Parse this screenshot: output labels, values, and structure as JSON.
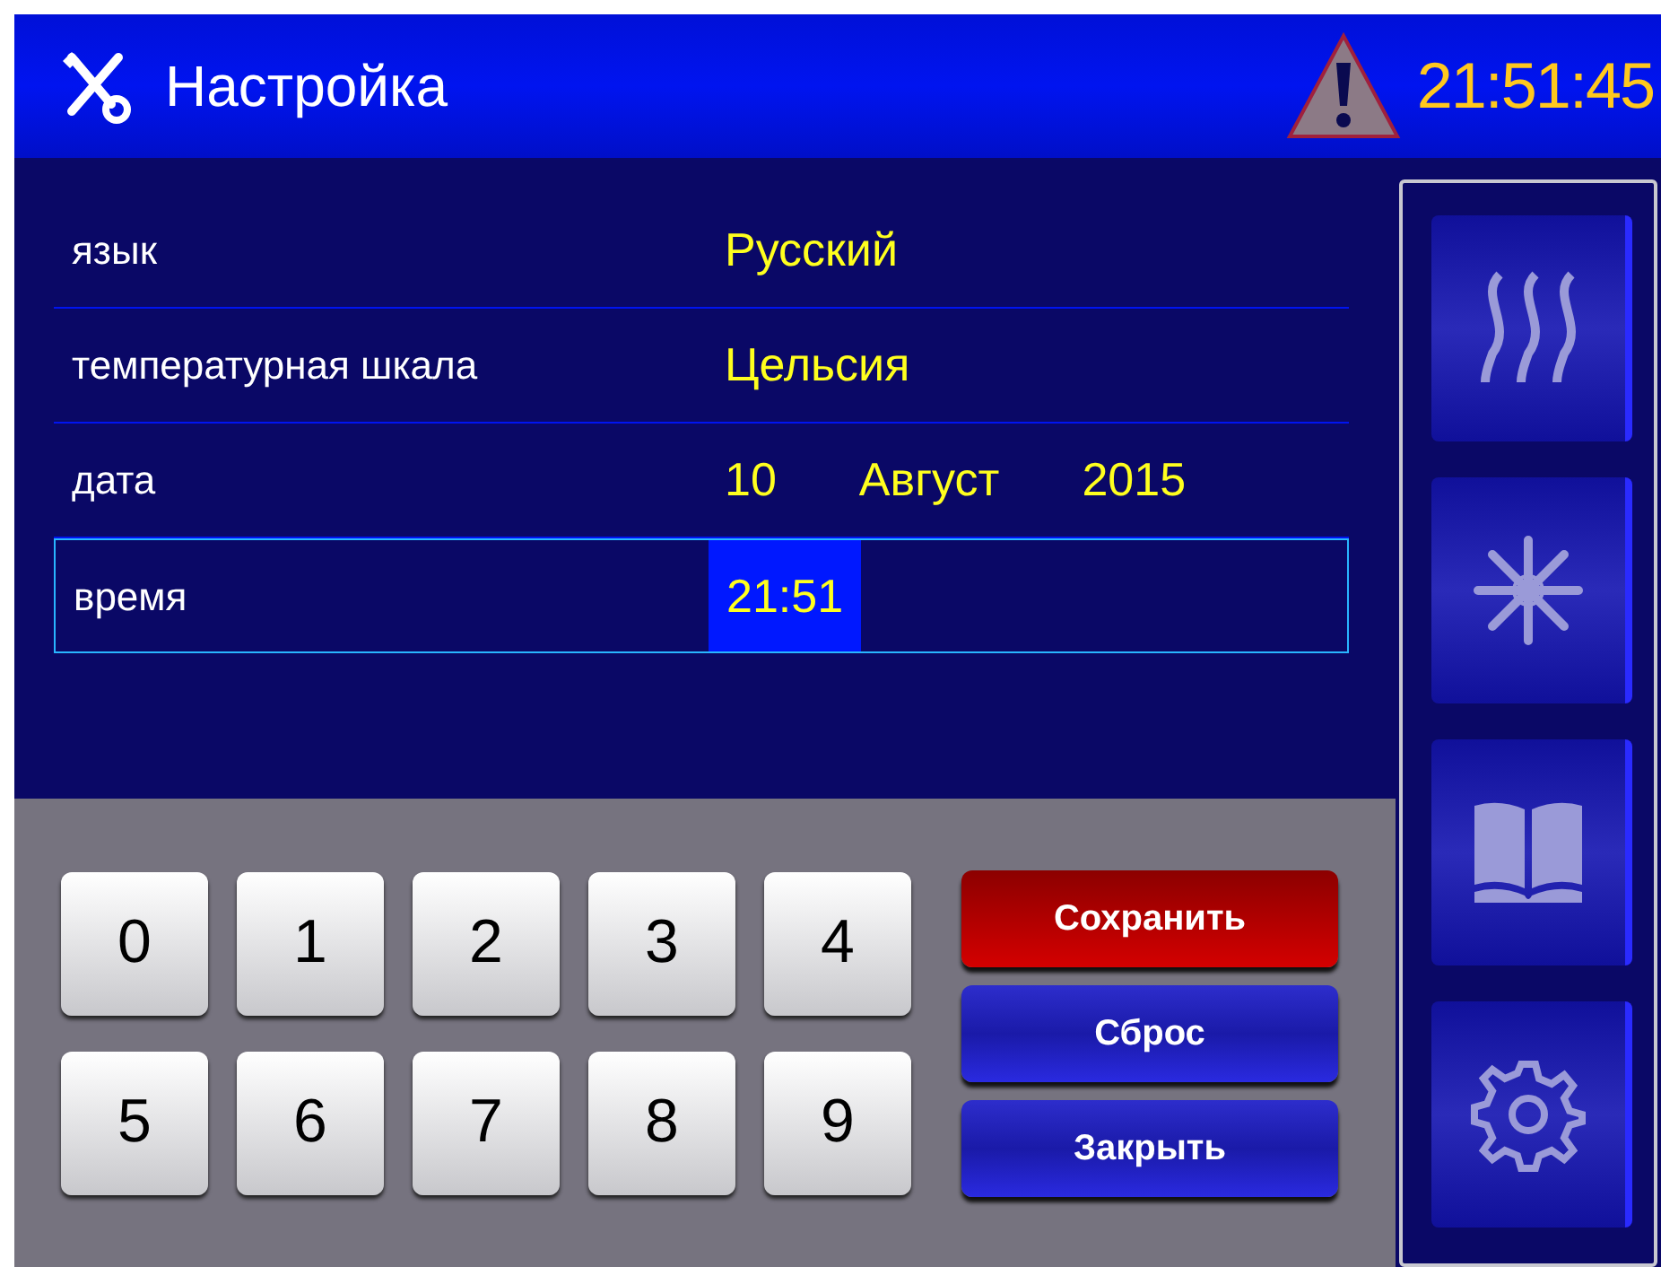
{
  "header": {
    "title": "Настройка",
    "clock": "21:51:45"
  },
  "rows": [
    {
      "label": "язык",
      "selected": false,
      "values": [
        {
          "text": "Русский",
          "selected": false
        }
      ]
    },
    {
      "label": "температурная шкала",
      "selected": false,
      "values": [
        {
          "text": "Цельсия",
          "selected": false
        }
      ]
    },
    {
      "label": "дата",
      "selected": false,
      "values": [
        {
          "text": "10",
          "selected": false
        },
        {
          "text": "Август",
          "selected": false
        },
        {
          "text": "2015",
          "selected": false
        }
      ]
    },
    {
      "label": "время",
      "selected": true,
      "values": [
        {
          "text": "21:51",
          "selected": true
        }
      ]
    }
  ],
  "keypad": [
    "0",
    "1",
    "2",
    "3",
    "4",
    "5",
    "6",
    "7",
    "8",
    "9"
  ],
  "actions": [
    {
      "label": "Сохранить",
      "kind": "save"
    },
    {
      "label": "Сброс",
      "kind": "default"
    },
    {
      "label": "Закрыть",
      "kind": "default"
    }
  ]
}
